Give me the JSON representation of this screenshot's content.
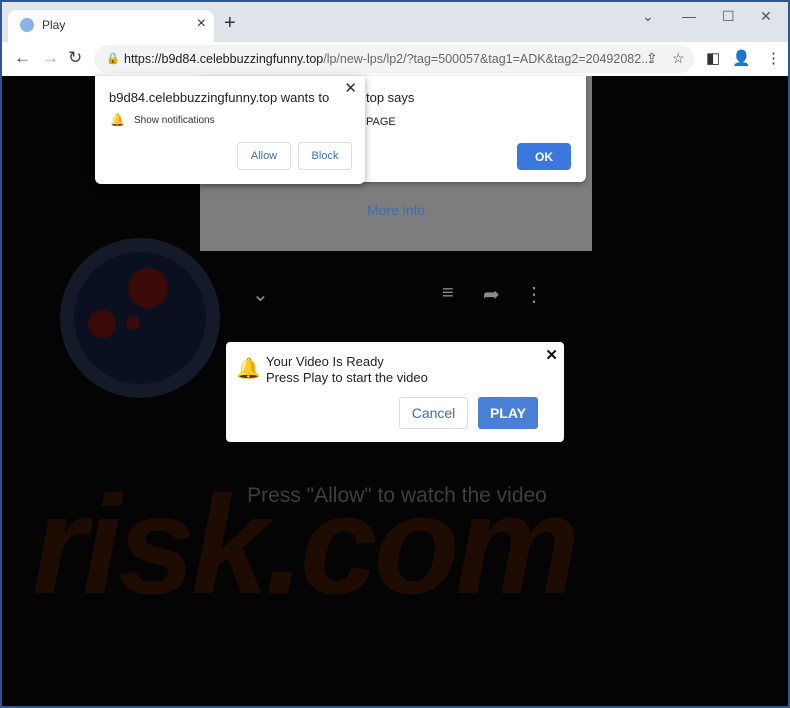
{
  "tab": {
    "title": "Play",
    "favicon": "bell-icon"
  },
  "address": {
    "host": "https://b9d84.celebbuzzingfunny.top",
    "path": "/lp/new-lps/lp2/?tag=500057&tag1=ADK&tag2=20492082..."
  },
  "permission": {
    "title": "b9d84.celebbuzzingfunny.top wants to",
    "item": "Show notifications",
    "allow": "Allow",
    "block": "Block"
  },
  "alert": {
    "says": "top says",
    "message": "PAGE",
    "ok": "OK",
    "more_info": "More info"
  },
  "dialog": {
    "line1": "Your Video Is Ready",
    "line2": "Press Play to start the video",
    "cancel": "Cancel",
    "play": "PLAY"
  },
  "page": {
    "press_allow": "Press \"Allow\" to watch the video"
  },
  "colors": {
    "accent": "#3b78de",
    "play": "#4a7fd6",
    "bell": "#e03030"
  }
}
